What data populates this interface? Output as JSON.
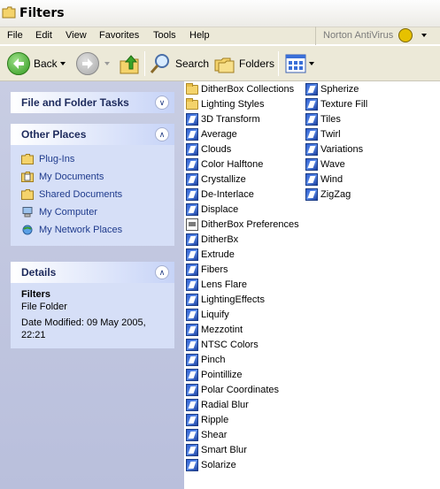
{
  "window": {
    "title": "Filters"
  },
  "menu": {
    "items": [
      "File",
      "Edit",
      "View",
      "Favorites",
      "Tools",
      "Help"
    ],
    "norton": "Norton AntiVirus"
  },
  "toolbar": {
    "back": "Back",
    "search": "Search",
    "folders": "Folders"
  },
  "sidebar": {
    "tasks": {
      "title": "File and Folder Tasks"
    },
    "other_places": {
      "title": "Other Places",
      "items": [
        {
          "label": "Plug-Ins",
          "icon": "folder-icon"
        },
        {
          "label": "My Documents",
          "icon": "my-documents-icon"
        },
        {
          "label": "Shared Documents",
          "icon": "folder-icon"
        },
        {
          "label": "My Computer",
          "icon": "computer-icon"
        },
        {
          "label": "My Network Places",
          "icon": "network-icon"
        }
      ]
    },
    "details": {
      "title": "Details",
      "name": "Filters",
      "type": "File Folder",
      "modified": "Date Modified: 09 May 2005, 22:21"
    }
  },
  "files": {
    "col1": [
      {
        "name": "DitherBox Collections",
        "icon": "folder"
      },
      {
        "name": "Lighting Styles",
        "icon": "folder"
      },
      {
        "name": "3D Transform",
        "icon": "plugin"
      },
      {
        "name": "Average",
        "icon": "plugin"
      },
      {
        "name": "Clouds",
        "icon": "plugin"
      },
      {
        "name": "Color Halftone",
        "icon": "plugin"
      },
      {
        "name": "Crystallize",
        "icon": "plugin"
      },
      {
        "name": "De-Interlace",
        "icon": "plugin"
      },
      {
        "name": "Displace",
        "icon": "plugin"
      },
      {
        "name": "DitherBox Preferences",
        "icon": "document"
      },
      {
        "name": "DitherBx",
        "icon": "plugin"
      },
      {
        "name": "Extrude",
        "icon": "plugin"
      },
      {
        "name": "Fibers",
        "icon": "plugin"
      },
      {
        "name": "Lens Flare",
        "icon": "plugin"
      },
      {
        "name": "LightingEffects",
        "icon": "plugin"
      },
      {
        "name": "Liquify",
        "icon": "plugin"
      },
      {
        "name": "Mezzotint",
        "icon": "plugin"
      },
      {
        "name": "NTSC Colors",
        "icon": "plugin"
      },
      {
        "name": "Pinch",
        "icon": "plugin"
      },
      {
        "name": "Pointillize",
        "icon": "plugin"
      },
      {
        "name": "Polar Coordinates",
        "icon": "plugin"
      },
      {
        "name": "Radial Blur",
        "icon": "plugin"
      },
      {
        "name": "Ripple",
        "icon": "plugin"
      },
      {
        "name": "Shear",
        "icon": "plugin"
      },
      {
        "name": "Smart Blur",
        "icon": "plugin"
      },
      {
        "name": "Solarize",
        "icon": "plugin"
      }
    ],
    "col2": [
      {
        "name": "Spherize",
        "icon": "plugin"
      },
      {
        "name": "Texture Fill",
        "icon": "plugin"
      },
      {
        "name": "Tiles",
        "icon": "plugin"
      },
      {
        "name": "Twirl",
        "icon": "plugin"
      },
      {
        "name": "Variations",
        "icon": "plugin"
      },
      {
        "name": "Wave",
        "icon": "plugin"
      },
      {
        "name": "Wind",
        "icon": "plugin"
      },
      {
        "name": "ZigZag",
        "icon": "plugin"
      }
    ]
  }
}
